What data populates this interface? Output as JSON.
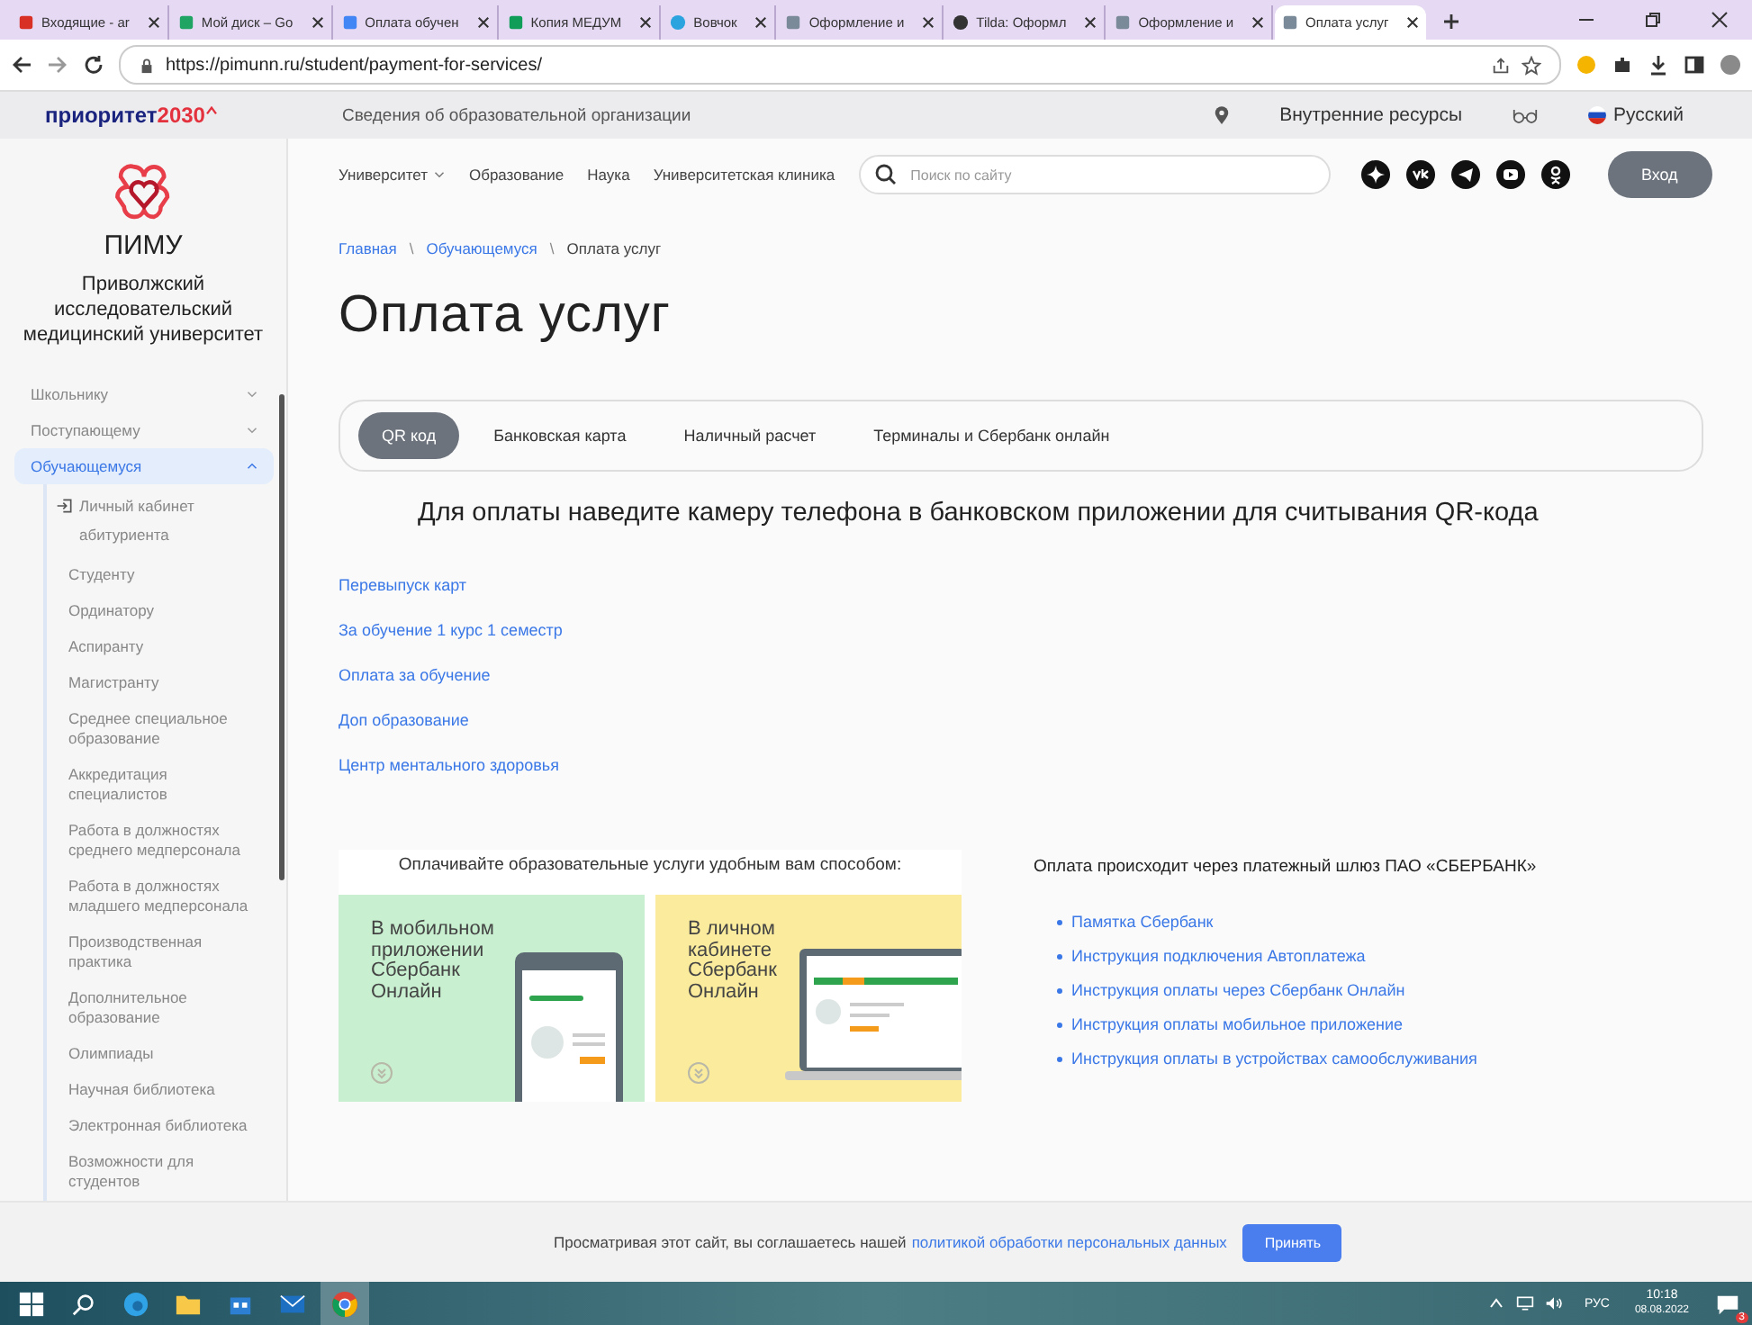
{
  "browser": {
    "tabs": [
      {
        "label": "Входящие - ar",
        "kind": "mail",
        "selected": false
      },
      {
        "label": "Мой диск – Go",
        "kind": "drive",
        "selected": false
      },
      {
        "label": "Оплата обучен",
        "kind": "doc",
        "selected": false
      },
      {
        "label": "Копия МЕДУМ",
        "kind": "sheet",
        "selected": false
      },
      {
        "label": "Вовчок",
        "kind": "telegram",
        "selected": false
      },
      {
        "label": "Оформление и",
        "kind": "grid",
        "selected": false
      },
      {
        "label": "Tilda: Оформл",
        "kind": "tilda",
        "selected": false
      },
      {
        "label": "Оформление и",
        "kind": "grid",
        "selected": false
      },
      {
        "label": "Оплата услуг",
        "kind": "grid",
        "selected": true
      }
    ],
    "url": "https://pimunn.ru/student/payment-for-services/"
  },
  "topbar": {
    "brand_word": "приоритет",
    "brand_number": "2030",
    "info_link": "Сведения об образовательной организации",
    "internal_resources": "Внутренние ресурсы",
    "language": "Русский"
  },
  "sidebar": {
    "logo_text": "ПИМУ",
    "university_name": "Приволжский исследовательский медицинский университет",
    "menu": [
      {
        "label": "Школьнику",
        "expanded": false,
        "selected": false
      },
      {
        "label": "Поступающему",
        "expanded": false,
        "selected": false
      },
      {
        "label": "Обучающемуся",
        "expanded": true,
        "selected": true,
        "children": [
          {
            "label": "Личный кабинет абитуриента",
            "kind": "login"
          },
          {
            "label": "Студенту",
            "kind": "link"
          },
          {
            "label": "Ординатору",
            "kind": "link"
          },
          {
            "label": "Аспиранту",
            "kind": "link"
          },
          {
            "label": "Магистранту",
            "kind": "link"
          },
          {
            "label": "Среднее специальное образование",
            "kind": "link"
          },
          {
            "label": "Аккредитация специалистов",
            "kind": "link"
          },
          {
            "label": "Работа в должностях среднего медперсонала",
            "kind": "link"
          },
          {
            "label": "Работа в должностях младшего медперсонала",
            "kind": "link"
          },
          {
            "label": "Производственная практика",
            "kind": "link"
          },
          {
            "label": "Дополнительное образование",
            "kind": "link"
          },
          {
            "label": "Олимпиады",
            "kind": "link"
          },
          {
            "label": "Научная библиотека",
            "kind": "link"
          },
          {
            "label": "Электронная библиотека",
            "kind": "link"
          },
          {
            "label": "Возможности для студентов",
            "kind": "link"
          }
        ]
      }
    ]
  },
  "nav": {
    "items": [
      {
        "label": "Университет",
        "dropdown": true
      },
      {
        "label": "Образование",
        "dropdown": false
      },
      {
        "label": "Наука",
        "dropdown": false
      },
      {
        "label": "Университетская клиника",
        "dropdown": false
      }
    ],
    "search": {
      "placeholder": "Поиск по сайту"
    },
    "login_button": "Вход"
  },
  "breadcrumbs": [
    {
      "kind": "crumb",
      "label": "Главная",
      "current": false
    },
    {
      "kind": "separator",
      "label": "\\"
    },
    {
      "kind": "crumb",
      "label": "Обучающемуся",
      "current": false
    },
    {
      "kind": "separator",
      "label": "\\"
    },
    {
      "kind": "crumb",
      "label": "Оплата услуг",
      "current": true
    }
  ],
  "title": "Оплата услуг",
  "payment_tabs": [
    {
      "label": "QR код",
      "selected": true
    },
    {
      "label": "Банковская карта",
      "selected": false
    },
    {
      "label": "Наличный расчет",
      "selected": false
    },
    {
      "label": "Терминалы и Сбербанк онлайн",
      "selected": false
    }
  ],
  "qr_heading": "Для оплаты наведите камеру телефона в банковском приложении для считывания QR-кода",
  "payment_links": [
    "Перевыпуск карт",
    "За обучение 1 курс 1 семестр",
    "Оплата за обучение",
    "Доп образование",
    "Центр ментального здоровья"
  ],
  "promo": {
    "caption": "Оплачивайте образовательные услуги удобным вам способом:",
    "cards": [
      {
        "text": "В мобильном приложении Сбербанк Онлайн",
        "kind": "phone",
        "color": "#c8efcf"
      },
      {
        "text": "В личном кабинете Сбербанк Онлайн",
        "kind": "laptop",
        "color": "#fbeb9c"
      }
    ]
  },
  "gateway": {
    "heading": "Оплата происходит через платежный шлюз ПАО «СБЕРБАНК»",
    "links": [
      "Памятка Сбербанк",
      "Инструкция подключения Автоплатежа",
      "Инструкция оплаты через Сбербанк Онлайн",
      "Инструкция оплаты мобильное приложение",
      "Инструкция оплаты в устройствах самообслуживания"
    ]
  },
  "cookie": {
    "text": "Просматривая этот сайт, вы соглашаетесь нашей",
    "link": "политикой обработки персональных данных",
    "button": "Принять"
  },
  "taskbar": {
    "language": "РУС",
    "time": "10:18",
    "date": "08.08.2022",
    "notification_count": "3"
  }
}
